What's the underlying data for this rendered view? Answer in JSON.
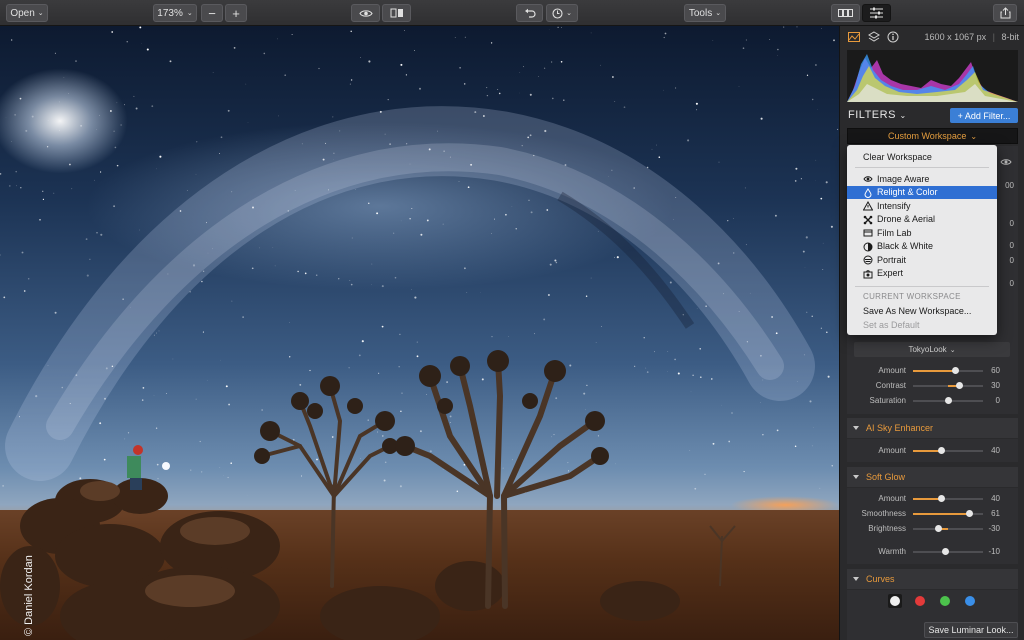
{
  "toolbar": {
    "open_label": "Open",
    "zoom_value": "173%",
    "zoom_out": "−",
    "zoom_in": "+",
    "tools_label": "Tools"
  },
  "canvas": {
    "watermark": "© Daniel Kordan"
  },
  "panel": {
    "dimensions": "1600 x 1067 px",
    "bit_depth": "8-bit",
    "filters_title": "FILTERS",
    "add_filter": "+ Add Filter...",
    "workspace": "Custom Workspace",
    "look_select": "TokyoLook",
    "look_sliders": [
      {
        "label": "Amount",
        "value": "60",
        "level": 0.6,
        "color": "#e89a3c"
      },
      {
        "label": "Contrast",
        "value": "30",
        "level": 0.65,
        "color": "#e89a3c"
      },
      {
        "label": "Saturation",
        "value": "0",
        "level": 0.5,
        "color": "#c0497a"
      }
    ],
    "sections": [
      {
        "title": "AI Sky Enhancer",
        "sliders": [
          {
            "label": "Amount",
            "value": "40",
            "level": 0.4,
            "color": "#e89a3c"
          }
        ]
      },
      {
        "title": "Soft Glow",
        "sliders": [
          {
            "label": "Amount",
            "value": "40",
            "level": 0.4,
            "color": "#e89a3c"
          },
          {
            "label": "Smoothness",
            "value": "61",
            "level": 0.8,
            "color": "#e89a3c"
          },
          {
            "label": "Brightness",
            "value": "-30",
            "level": 0.35,
            "color": "#e89a3c"
          },
          {
            "label": "Warmth",
            "value": "-10",
            "level": 0.45,
            "color": "#5a8fd6"
          }
        ]
      },
      {
        "title": "Curves"
      }
    ],
    "curve_channels": [
      "#f0f0f0",
      "#e33a3a",
      "#4cc24c",
      "#3a8fe8"
    ],
    "save_look": "Save Luminar Look...",
    "hidden_values": [
      "00",
      "0",
      "0",
      "0",
      "0"
    ]
  },
  "menu": {
    "clear": "Clear Workspace",
    "items": [
      {
        "label": "Image Aware",
        "icon": "eye-icon"
      },
      {
        "label": "Relight & Color",
        "icon": "drop-icon",
        "selected": true
      },
      {
        "label": "Intensify",
        "icon": "triangle-icon"
      },
      {
        "label": "Drone & Aerial",
        "icon": "drone-icon"
      },
      {
        "label": "Film Lab",
        "icon": "film-icon"
      },
      {
        "label": "Black & White",
        "icon": "half-circle-icon"
      },
      {
        "label": "Portrait",
        "icon": "portrait-icon"
      },
      {
        "label": "Expert",
        "icon": "camera-icon"
      }
    ],
    "current_header": "CURRENT WORKSPACE",
    "save_new": "Save As New Workspace...",
    "set_default": "Set as Default"
  }
}
